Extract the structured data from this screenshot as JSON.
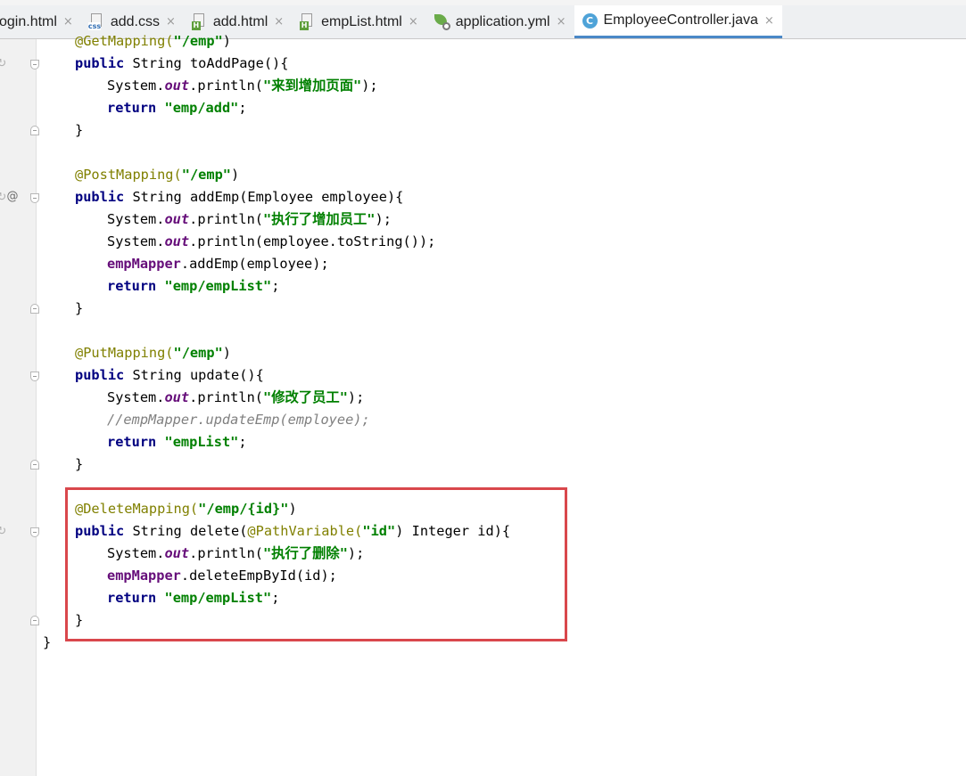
{
  "tabs": [
    {
      "label": "ogin.html",
      "icon": "html-file-icon"
    },
    {
      "label": "add.css",
      "icon": "css-file-icon"
    },
    {
      "label": "add.html",
      "icon": "html-file-icon"
    },
    {
      "label": "empList.html",
      "icon": "html-file-icon"
    },
    {
      "label": "application.yml",
      "icon": "yml-config-icon"
    },
    {
      "label": "EmployeeController.java",
      "icon": "java-class-icon",
      "active": true
    }
  ],
  "close_glyph": "×",
  "gutter": {
    "override_marker": "@"
  },
  "colors": {
    "annotation": "#808000",
    "keyword": "#000080",
    "string": "#008000",
    "field": "#660e7a",
    "comment": "#808080",
    "highlight_border": "#d9474c",
    "active_tab_underline": "#4a88c7"
  },
  "code_lines": [
    {
      "indent": 4,
      "tokens": [
        {
          "t": "@GetMapping(",
          "c": "ann"
        },
        {
          "t": "\"/emp\"",
          "c": "str"
        },
        {
          "t": ")"
        }
      ]
    },
    {
      "indent": 4,
      "tokens": [
        {
          "t": "public",
          "c": "kw"
        },
        {
          "t": " String toAddPage(){"
        }
      ]
    },
    {
      "indent": 8,
      "tokens": [
        {
          "t": "System."
        },
        {
          "t": "out",
          "c": "fld"
        },
        {
          "t": ".println("
        },
        {
          "t": "\"来到增加页面\"",
          "c": "str"
        },
        {
          "t": ");"
        }
      ]
    },
    {
      "indent": 8,
      "tokens": [
        {
          "t": "return",
          "c": "kw"
        },
        {
          "t": " "
        },
        {
          "t": "\"emp/add\"",
          "c": "str"
        },
        {
          "t": ";"
        }
      ]
    },
    {
      "indent": 4,
      "tokens": [
        {
          "t": "}"
        }
      ]
    },
    {
      "indent": 0,
      "tokens": []
    },
    {
      "indent": 4,
      "tokens": [
        {
          "t": "@PostMapping(",
          "c": "ann"
        },
        {
          "t": "\"/emp\"",
          "c": "str"
        },
        {
          "t": ")"
        }
      ]
    },
    {
      "indent": 4,
      "tokens": [
        {
          "t": "public",
          "c": "kw"
        },
        {
          "t": " String addEmp(Employee employee){"
        }
      ]
    },
    {
      "indent": 8,
      "tokens": [
        {
          "t": "System."
        },
        {
          "t": "out",
          "c": "fld"
        },
        {
          "t": ".println("
        },
        {
          "t": "\"执行了增加员工\"",
          "c": "str"
        },
        {
          "t": ");"
        }
      ]
    },
    {
      "indent": 8,
      "tokens": [
        {
          "t": "System."
        },
        {
          "t": "out",
          "c": "fld"
        },
        {
          "t": ".println(employee.toString());"
        }
      ]
    },
    {
      "indent": 8,
      "tokens": [
        {
          "t": "empMapper",
          "c": "inst"
        },
        {
          "t": ".addEmp(employee);"
        }
      ]
    },
    {
      "indent": 8,
      "tokens": [
        {
          "t": "return",
          "c": "kw"
        },
        {
          "t": " "
        },
        {
          "t": "\"emp/empList\"",
          "c": "str"
        },
        {
          "t": ";"
        }
      ]
    },
    {
      "indent": 4,
      "tokens": [
        {
          "t": "}"
        }
      ]
    },
    {
      "indent": 0,
      "tokens": []
    },
    {
      "indent": 4,
      "tokens": [
        {
          "t": "@PutMapping(",
          "c": "ann"
        },
        {
          "t": "\"/emp\"",
          "c": "str"
        },
        {
          "t": ")"
        }
      ]
    },
    {
      "indent": 4,
      "tokens": [
        {
          "t": "public",
          "c": "kw"
        },
        {
          "t": " String update(){"
        }
      ]
    },
    {
      "indent": 8,
      "tokens": [
        {
          "t": "System."
        },
        {
          "t": "out",
          "c": "fld"
        },
        {
          "t": ".println("
        },
        {
          "t": "\"修改了员工\"",
          "c": "str"
        },
        {
          "t": ");"
        }
      ]
    },
    {
      "indent": 8,
      "tokens": [
        {
          "t": "//empMapper.updateEmp(employee);",
          "c": "cmt"
        }
      ]
    },
    {
      "indent": 8,
      "tokens": [
        {
          "t": "return",
          "c": "kw"
        },
        {
          "t": " "
        },
        {
          "t": "\"empList\"",
          "c": "str"
        },
        {
          "t": ";"
        }
      ]
    },
    {
      "indent": 4,
      "tokens": [
        {
          "t": "}"
        }
      ]
    },
    {
      "indent": 0,
      "tokens": []
    },
    {
      "indent": 4,
      "tokens": [
        {
          "t": "@DeleteMapping(",
          "c": "ann"
        },
        {
          "t": "\"/emp/{id}\"",
          "c": "str"
        },
        {
          "t": ")"
        }
      ]
    },
    {
      "indent": 4,
      "tokens": [
        {
          "t": "public",
          "c": "kw"
        },
        {
          "t": " String delete("
        },
        {
          "t": "@PathVariable(",
          "c": "ann"
        },
        {
          "t": "\"id\"",
          "c": "str"
        },
        {
          "t": ") Integer id){"
        }
      ]
    },
    {
      "indent": 8,
      "tokens": [
        {
          "t": "System."
        },
        {
          "t": "out",
          "c": "fld"
        },
        {
          "t": ".println("
        },
        {
          "t": "\"执行了删除\"",
          "c": "str"
        },
        {
          "t": ");"
        }
      ]
    },
    {
      "indent": 8,
      "tokens": [
        {
          "t": "empMapper",
          "c": "inst"
        },
        {
          "t": ".deleteEmpById(id);"
        }
      ]
    },
    {
      "indent": 8,
      "tokens": [
        {
          "t": "return",
          "c": "kw"
        },
        {
          "t": " "
        },
        {
          "t": "\"emp/empList\"",
          "c": "str"
        },
        {
          "t": ";"
        }
      ]
    },
    {
      "indent": 4,
      "tokens": [
        {
          "t": "}"
        }
      ]
    },
    {
      "indent": 0,
      "tokens": [
        {
          "t": "}"
        }
      ]
    }
  ]
}
